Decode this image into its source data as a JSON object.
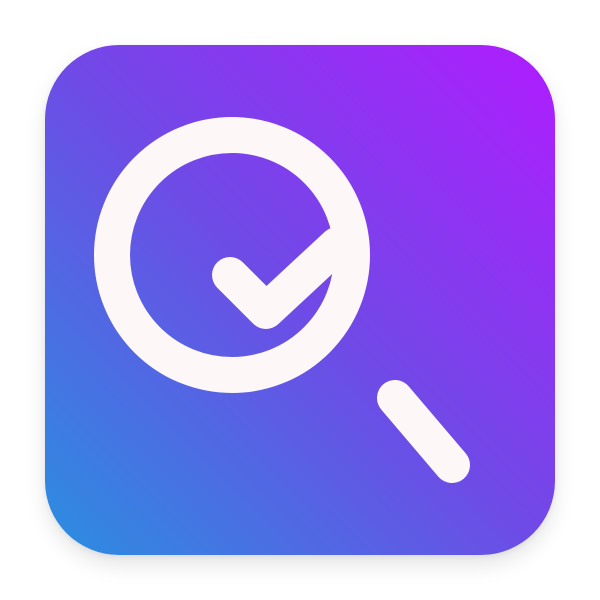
{
  "icon": {
    "name": "search-check",
    "description_icons": [
      "magnifier-icon",
      "checkmark-icon"
    ],
    "colors": {
      "gradient_start": "#2a8fe0",
      "gradient_mid": "#6f4ae6",
      "gradient_end": "#b01cff",
      "glyph": "#fdf8f7"
    }
  }
}
